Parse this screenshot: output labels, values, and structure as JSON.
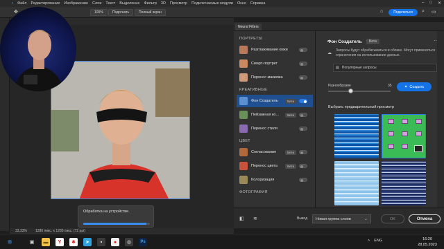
{
  "menubar": {
    "items": [
      "Файл",
      "Редактирование",
      "Изображение",
      "Слои",
      "Текст",
      "Выделение",
      "Фильтр",
      "3D",
      "Просмотр",
      "Подключаемые модули",
      "Окно",
      "Справка"
    ],
    "window_controls": [
      "–",
      "□",
      "✕"
    ]
  },
  "optionsbar": {
    "zoom": "100%",
    "fit_label": "Подогнать",
    "fullscreen_label": "Полный экран",
    "share_label": "Поделиться"
  },
  "canvas": {
    "progress_text": "Обработка на устройстве.",
    "progress_fraction": 0.95
  },
  "statusbar": {
    "zoom": "33,33%",
    "doc_info": "1280 пикс. x 1280 пикс. (72 ppi)"
  },
  "neural_filters": {
    "tab_label": "Neural Filters",
    "sections": [
      {
        "title": "ПОРТРЕТЫ",
        "items": [
          {
            "label": "Разглаживание кожи",
            "badge": "",
            "on": false,
            "selected": false,
            "thumb": "#b87a5a"
          },
          {
            "label": "Смарт-портрет",
            "badge": "",
            "on": false,
            "selected": false,
            "thumb": "#c98a62"
          },
          {
            "label": "Перенос макияжа",
            "badge": "",
            "on": false,
            "selected": false,
            "thumb": "#d19a7a"
          }
        ]
      },
      {
        "title": "КРЕАТИВНЫЕ",
        "items": [
          {
            "label": "Фон Создатель",
            "badge": "Бета",
            "on": true,
            "selected": true,
            "thumb": "#5a8fd1"
          },
          {
            "label": "Пейзажная ко...",
            "badge": "Бета",
            "on": false,
            "selected": false,
            "thumb": "#6a8f5a"
          },
          {
            "label": "Перенос стиля",
            "badge": "",
            "on": false,
            "selected": false,
            "thumb": "#8a6ab0"
          }
        ]
      },
      {
        "title": "ЦВЕТ",
        "items": [
          {
            "label": "Согласование",
            "badge": "Бета",
            "on": false,
            "selected": false,
            "thumb": "#b06a3a"
          },
          {
            "label": "Перенос цвета",
            "badge": "Бета",
            "on": false,
            "selected": false,
            "thumb": "#c8523a"
          },
          {
            "label": "Колоризация",
            "badge": "",
            "on": false,
            "selected": false,
            "thumb": "#9a8a5a"
          }
        ]
      },
      {
        "title": "ФОТОГРАФИЯ",
        "items": []
      }
    ],
    "detail": {
      "title": "Фон Создатель",
      "badge": "Бета",
      "notice": "Запросы будут обрабатываться в облаке. Могут применяться ограничения на использование данных.",
      "popular_label": "Популярные запросы",
      "variety_label": "Разнообразие",
      "variety_value": "35",
      "create_label": "Создать",
      "preview_label": "Выбрать предварительный просмотр"
    },
    "output_label": "Вывод",
    "output_value": "Новая группа слоев",
    "ok_label": "OK",
    "cancel_label": "Отмена"
  },
  "taskbar": {
    "lang": "ENG",
    "time": "16:20",
    "date": "28.05.2023"
  }
}
